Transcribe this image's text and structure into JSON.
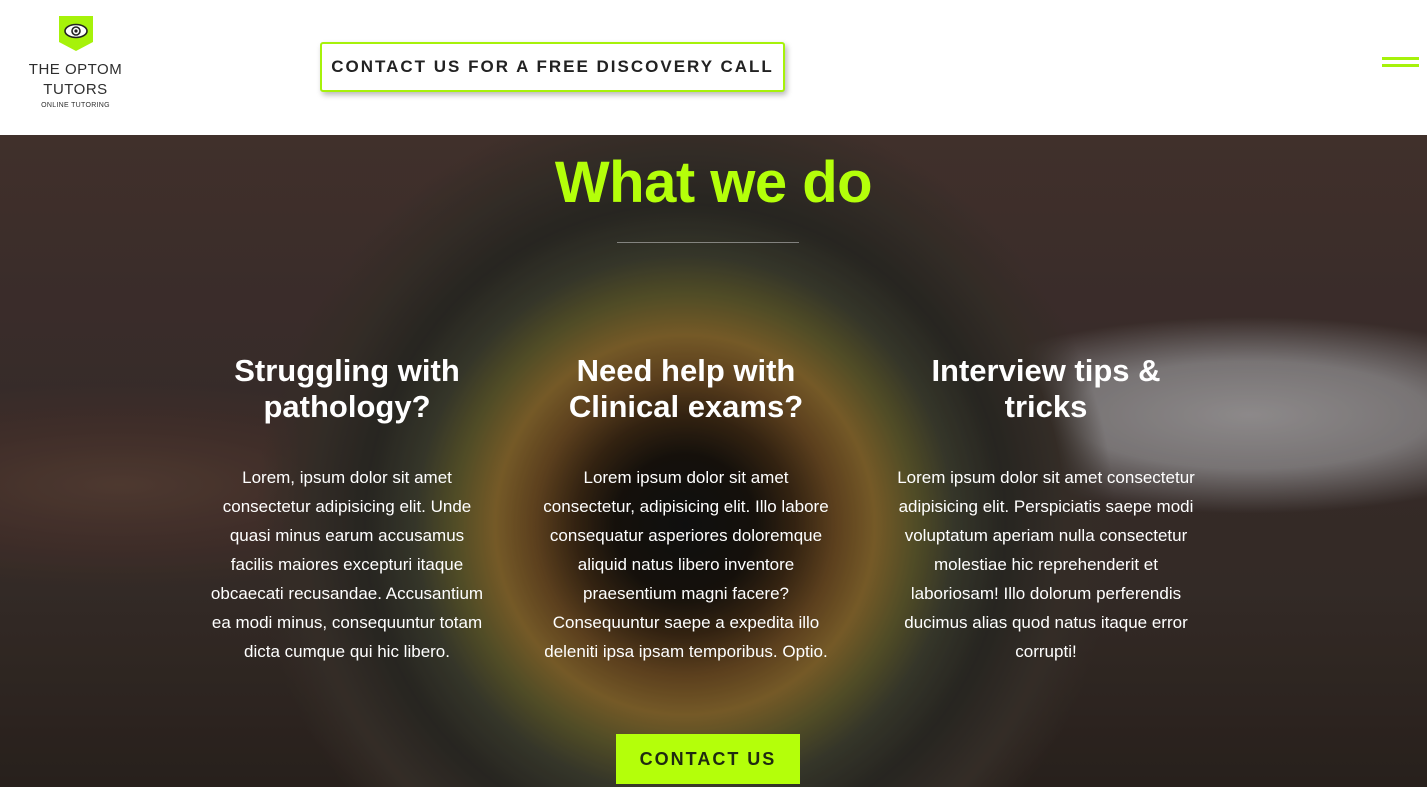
{
  "brand": {
    "line1": "THE OPTOM",
    "line2": "TUTORS",
    "tagline": "ONLINE TUTORING",
    "accent_color": "#a6f20a",
    "icon": "eye-icon"
  },
  "header": {
    "cta_label": "CONTACT US FOR A FREE DISCOVERY CALL",
    "menu_icon": "hamburger-menu-icon"
  },
  "hero": {
    "title": "What we do",
    "title_color": "#b4ff0a",
    "columns": [
      {
        "heading": "Struggling with pathology?",
        "body": "Lorem, ipsum dolor sit amet consectetur adipisicing elit. Unde quasi minus earum accusamus facilis maiores excepturi itaque obcaecati recusandae. Accusantium ea modi minus, consequuntur totam dicta cumque qui hic libero."
      },
      {
        "heading": "Need help with Clinical exams?",
        "body": "Lorem ipsum dolor sit amet consectetur, adipisicing elit. Illo labore consequatur asperiores doloremque aliquid natus libero inventore praesentium magni facere? Consequuntur saepe a expedita illo deleniti ipsa ipsam temporibus. Optio."
      },
      {
        "heading": "Interview tips & tricks",
        "body": "Lorem ipsum dolor sit amet consectetur adipisicing elit. Perspiciatis saepe modi voluptatum aperiam nulla consectetur molestiae hic reprehenderit et laboriosam! Illo dolorum perferendis ducimus alias quod natus itaque error corrupti!"
      }
    ],
    "contact_label": "CONTACT US"
  }
}
